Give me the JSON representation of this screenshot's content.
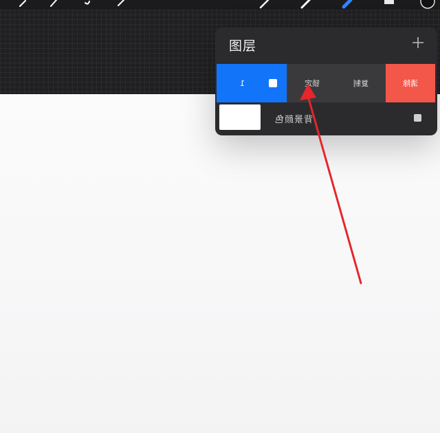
{
  "toolbar": {
    "tools": [
      "wrench-icon",
      "magic-wand-icon",
      "selection-icon",
      "transform-icon",
      "brush-icon",
      "smudge-icon",
      "eraser-icon",
      "layers-icon",
      "color-icon"
    ]
  },
  "layers_panel": {
    "title": "图层",
    "add_symbol": "+",
    "swipe_actions": {
      "layer_label": "1",
      "lock_label": "锁定",
      "copy_label": "复制",
      "delete_label": "清除"
    },
    "background_label": "背景颜色"
  },
  "colors": {
    "accent_blue": "#1275f9",
    "delete_red": "#f2574a",
    "arrow_red": "#e5262b",
    "panel_bg": "#2b2b2e"
  }
}
